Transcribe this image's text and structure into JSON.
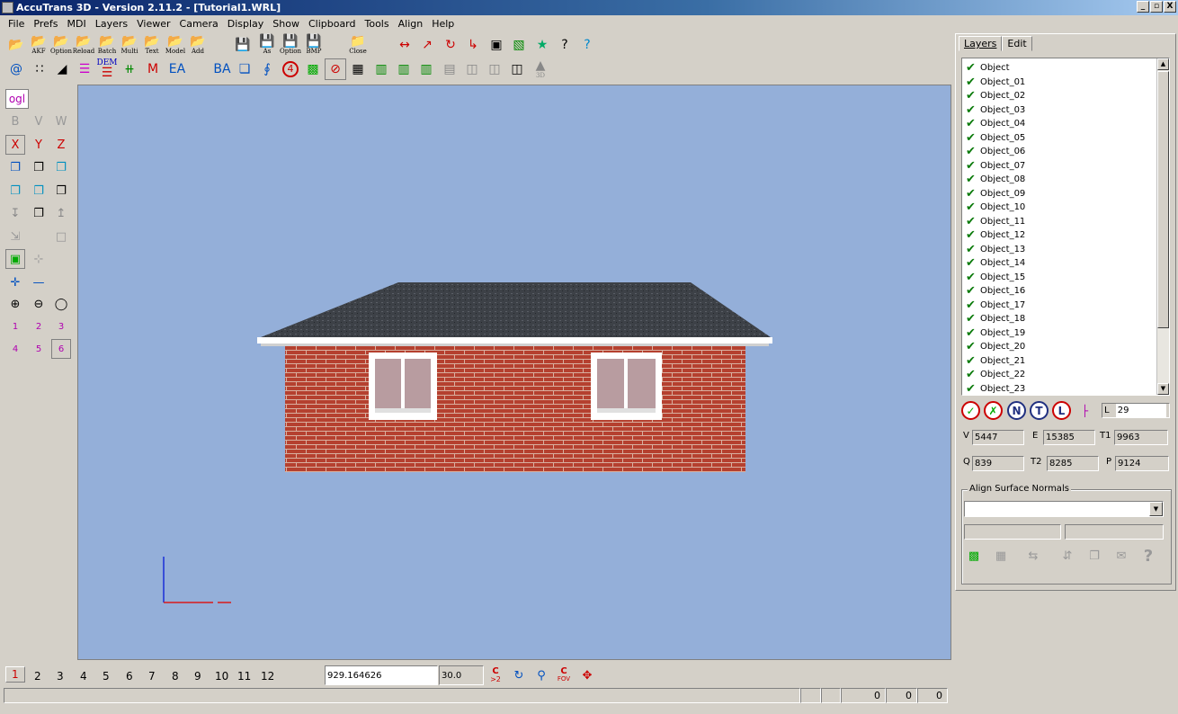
{
  "window": {
    "title": "AccuTrans 3D - Version 2.11.2 - [Tutorial1.WRL]",
    "buttons": [
      "_",
      "▫",
      "X"
    ]
  },
  "menu": [
    "File",
    "Prefs",
    "MDI",
    "Layers",
    "Viewer",
    "Camera",
    "Display",
    "Show",
    "Clipboard",
    "Tools",
    "Align",
    "Help"
  ],
  "toolbar": {
    "open_labels": [
      "AKF",
      "Option",
      "Reload",
      "Batch",
      "Multi",
      "Text",
      "Model",
      "Add"
    ],
    "save_labels": [
      "As",
      "Option",
      "BMP"
    ],
    "close_label": "Close",
    "row2_text": {
      "at": "@",
      "dem": "DEM",
      "ea": "EA",
      "ba": "BA",
      "num4": "4",
      "m": "M",
      "to3d": "3D"
    }
  },
  "left_tools": {
    "ogl": "ogl",
    "bv": [
      "B",
      "V",
      "W"
    ],
    "axes": [
      "X",
      "Y",
      "Z"
    ],
    "zoom": [
      "1",
      "2",
      "3",
      "4",
      "5",
      "6"
    ]
  },
  "right_panel": {
    "tabs": [
      "Layers",
      "Edit"
    ],
    "layers": [
      "Object",
      "Object_01",
      "Object_02",
      "Object_03",
      "Object_04",
      "Object_05",
      "Object_06",
      "Object_07",
      "Object_08",
      "Object_09",
      "Object_10",
      "Object_11",
      "Object_12",
      "Object_13",
      "Object_14",
      "Object_15",
      "Object_16",
      "Object_17",
      "Object_18",
      "Object_19",
      "Object_20",
      "Object_21",
      "Object_22",
      "Object_23"
    ],
    "round_buttons": [
      "N",
      "T",
      "L"
    ],
    "stats": {
      "L_label": "L",
      "L": "29",
      "V_label": "V",
      "V": "5447",
      "E_label": "E",
      "E": "15385",
      "T1_label": "T1",
      "T1": "9963",
      "Q_label": "Q",
      "Q": "839",
      "T2_label": "T2",
      "T2": "8285",
      "P_label": "P",
      "P": "9124"
    },
    "align_group_title": "Align Surface Normals",
    "align_select_value": ""
  },
  "bottom": {
    "views": [
      "1",
      "2",
      "3",
      "4",
      "5",
      "6",
      "7",
      "8",
      "9",
      "10",
      "11",
      "12"
    ],
    "distance": "929.164626",
    "fov": "30.0",
    "cam_labels": {
      "c2": ">2",
      "fov": "FOV"
    },
    "status_cells": [
      "",
      "",
      "",
      "0",
      "0",
      "0"
    ]
  },
  "colors": {
    "viewport_bg": "#94afd9",
    "brick": "#b5402f",
    "roof": "#3d4147"
  }
}
